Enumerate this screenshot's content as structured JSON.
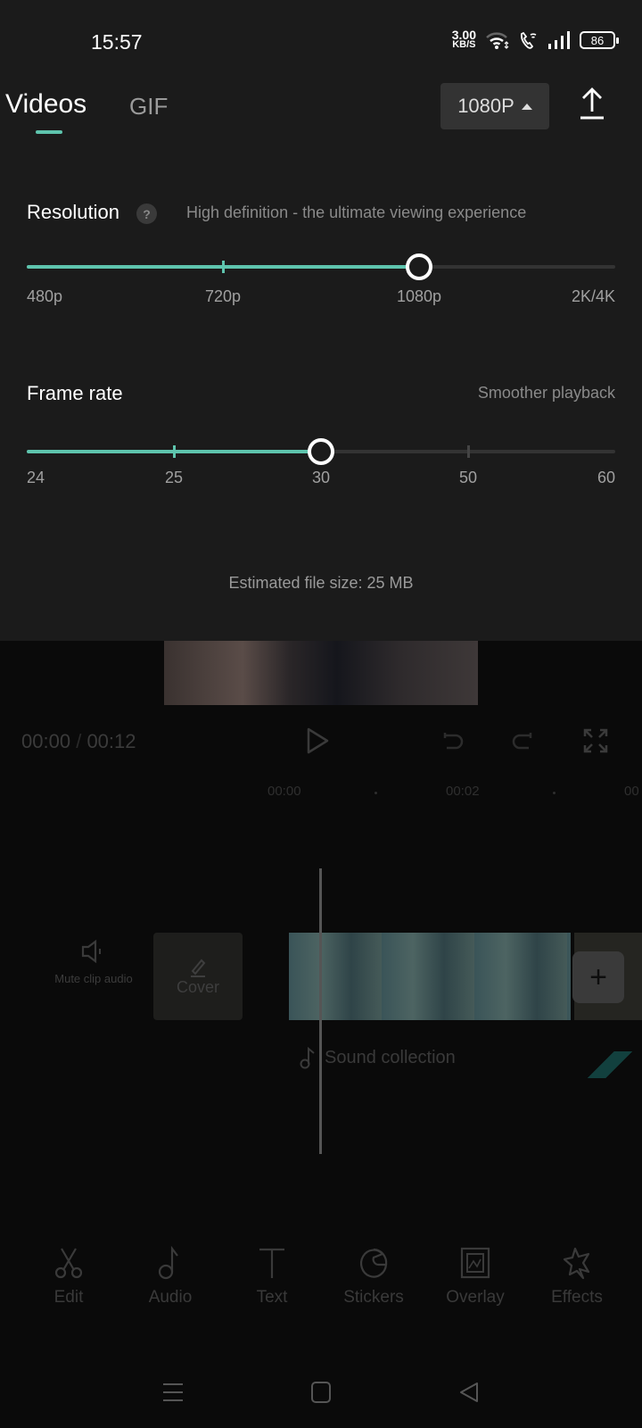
{
  "status_bar": {
    "time": "15:57",
    "net_speed_value": "3.00",
    "net_speed_unit": "KB/S",
    "battery": "86"
  },
  "export_sheet": {
    "tabs": [
      {
        "label": "Videos",
        "active": true
      },
      {
        "label": "GIF",
        "active": false
      }
    ],
    "resolution_button": "1080P",
    "resolution": {
      "label": "Resolution",
      "help": "?",
      "description": "High definition - the ultimate viewing experience",
      "options": [
        "480p",
        "720p",
        "1080p",
        "2K/4K"
      ],
      "selected_index": 2
    },
    "frame_rate": {
      "label": "Frame rate",
      "description": "Smoother playback",
      "options": [
        "24",
        "25",
        "30",
        "50",
        "60"
      ],
      "selected_index": 2
    },
    "estimated_file_size": "Estimated file size: 25 MB",
    "accent_color": "#5ec4ad"
  },
  "editor": {
    "current_time": "00:00",
    "separator": "/",
    "total_time": "00:12",
    "ruler": [
      "00:00",
      "00:02",
      "00"
    ],
    "mute_label": "Mute clip audio",
    "cover_label": "Cover",
    "add_clip": "+",
    "sound_label": "Sound collection",
    "toolbar": [
      {
        "label": "Edit",
        "icon": "scissors-icon"
      },
      {
        "label": "Audio",
        "icon": "music-note-icon"
      },
      {
        "label": "Text",
        "icon": "text-icon"
      },
      {
        "label": "Stickers",
        "icon": "sticker-icon"
      },
      {
        "label": "Overlay",
        "icon": "overlay-icon"
      },
      {
        "label": "Effects",
        "icon": "star-icon"
      }
    ]
  }
}
